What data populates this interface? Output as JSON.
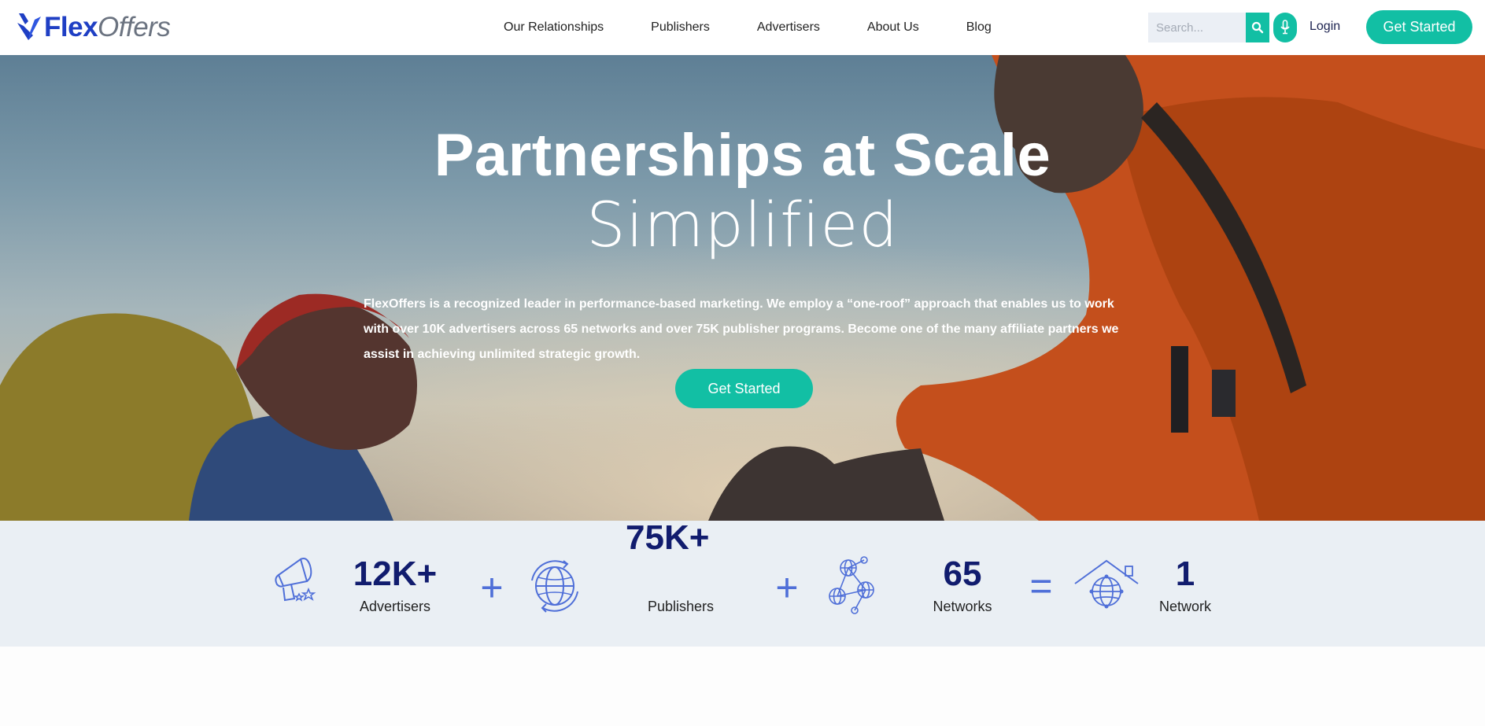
{
  "header": {
    "logo": {
      "flex": "Flex",
      "offers": "Offers"
    },
    "nav": [
      "Our Relationships",
      "Publishers",
      "Advertisers",
      "About Us",
      "Blog"
    ],
    "search": {
      "placeholder": "Search...",
      "search_icon": "search-icon",
      "mic_icon": "microphone-icon"
    },
    "login_label": "Login",
    "cta_label": "Get Started"
  },
  "hero": {
    "title": "Partnerships at Scale",
    "subtitle": "Simplified",
    "description": "FlexOffers is a recognized leader in performance-based marketing. We employ a “one-roof” approach that enables us to work with over 10K advertisers across 65 networks and over 75K publisher programs. Become one of the many affiliate partners we assist in achieving unlimited strategic growth.",
    "cta_label": "Get Started"
  },
  "stats": {
    "items": [
      {
        "icon": "megaphone-icon",
        "value": "12K+",
        "label": "Advertisers"
      },
      {
        "icon": "globe-cycle-icon",
        "value": "75K+",
        "label": "Publishers"
      },
      {
        "icon": "network-globes-icon",
        "value": "65",
        "label": "Networks"
      },
      {
        "icon": "house-globe-icon",
        "value": "1",
        "label": "Network"
      }
    ],
    "operators": [
      "+",
      "+",
      "="
    ]
  },
  "colors": {
    "brand_blue": "#1f3fc4",
    "accent_teal": "#12bfa4",
    "stat_navy": "#111c6e",
    "operator_blue": "#4f6fd8",
    "stats_background": "#eaeff4"
  }
}
